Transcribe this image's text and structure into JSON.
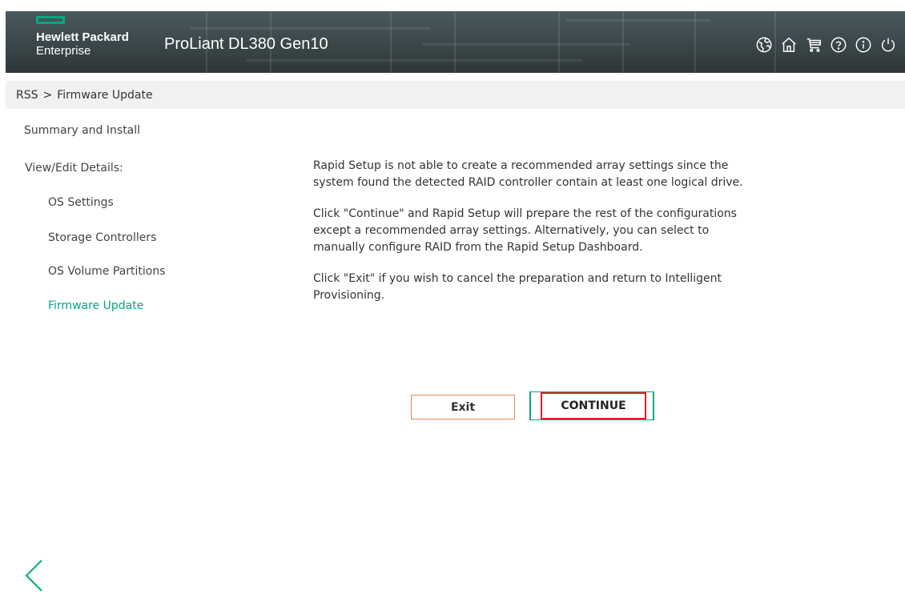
{
  "header": {
    "logo_line1": "Hewlett Packard",
    "logo_line2": "Enterprise",
    "product": "ProLiant DL380 Gen10",
    "accent_color": "#01a982",
    "icons": [
      "language-icon",
      "home-icon",
      "cart-icon",
      "help-icon",
      "info-icon",
      "power-icon"
    ]
  },
  "breadcrumb": {
    "root": "RSS",
    "separator": ">",
    "current": "Firmware Update"
  },
  "sidebar": {
    "summary": "Summary and Install",
    "details_heading": "View/Edit Details:",
    "items": [
      {
        "label": "OS Settings"
      },
      {
        "label": "Storage Controllers"
      },
      {
        "label": "OS Volume Partitions"
      },
      {
        "label": "Firmware Update",
        "active": true
      }
    ]
  },
  "message": {
    "p1": "Rapid Setup is not able to create a recommended array settings since the system found the detected RAID controller contain at least one logical drive.",
    "p2": "Click \"Continue\" and Rapid Setup will prepare the rest of the configurations except a recommended array settings. Alternatively, you can select to manually configure RAID from the Rapid Setup Dashboard.",
    "p3": "Click \"Exit\" if you wish to cancel the preparation and return to Intelligent Provisioning."
  },
  "buttons": {
    "exit_label": "Exit",
    "continue_label": "CONTINUE"
  }
}
